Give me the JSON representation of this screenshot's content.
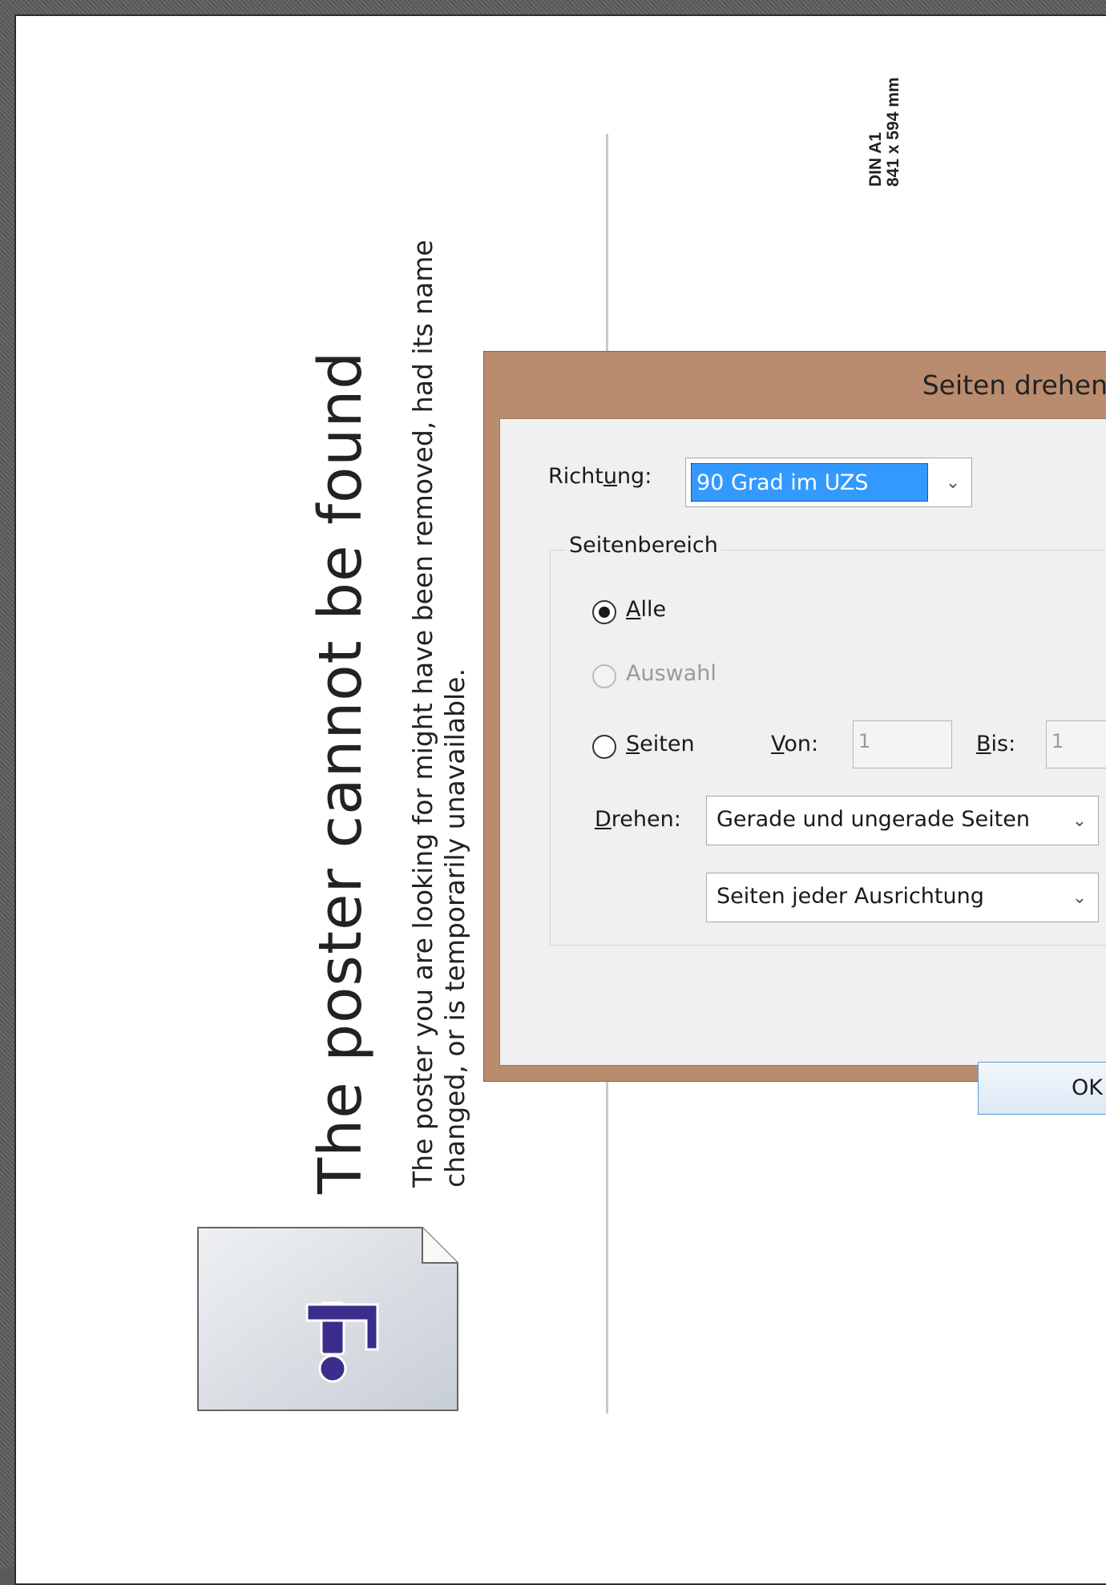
{
  "poster": {
    "title": "The poster cannot be found",
    "message": "The poster you are looking for might have been removed, had its name changed, or is temporarily unavailable.",
    "size_name": "DIN A1",
    "size_mm": "841 x 594 mm"
  },
  "dialog": {
    "title": "Seiten drehen",
    "richtung_label_pre": "Richt",
    "richtung_label_u": "u",
    "richtung_label_post": "ng:",
    "richtung_value": "90 Grad im UZS",
    "group_label": "Seitenbereich",
    "radio_alle_u": "A",
    "radio_alle_rest": "lle",
    "radio_auswahl": "Auswahl",
    "radio_seiten_u": "S",
    "radio_seiten_rest": "eiten",
    "von_u": "V",
    "von_rest": "on:",
    "von_value": "1",
    "bis_u": "B",
    "bis_rest": "is:",
    "bis_value": "1",
    "drehen_u": "D",
    "drehen_rest": "rehen:",
    "drehen_value": "Gerade und ungerade Seiten",
    "orientation_value": "Seiten jeder Ausrichtung",
    "ok_label": "OK",
    "selected_radio": "alle"
  },
  "colors": {
    "dialog_frame": "#b98c6f",
    "selection": "#3399ff",
    "icon_purple": "#3a2d8c"
  }
}
